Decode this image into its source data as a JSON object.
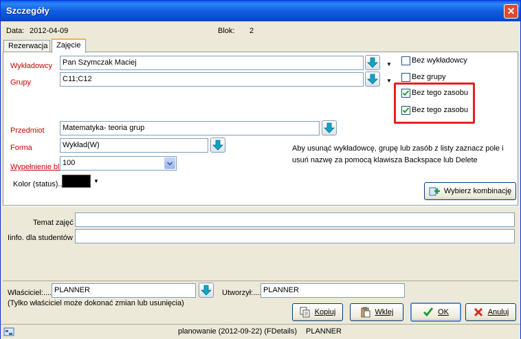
{
  "window": {
    "title": "Szczegóły"
  },
  "info": {
    "date_label": "Data:",
    "date_value": "2012-04-09",
    "block_label": "Blok:",
    "block_value": "2"
  },
  "tabs": [
    {
      "label": "Rezerwacja"
    },
    {
      "label": "Zajęcie"
    }
  ],
  "form": {
    "wykladowcy_label": "Wykładowcy",
    "wykladowcy_value": "Pan Szymczak Maciej",
    "grupy_label": "Grupy",
    "grupy_value": "C11;C12",
    "przedmiot_label": "Przedmiot",
    "przedmiot_value": "Matematyka- teoria grup",
    "forma_label": "Forma",
    "forma_value": "Wykład(W)",
    "wypelnienie_label": "Wypełnienie bl.",
    "wypelnienie_value": "100",
    "kolor_label": "Kolor (status)..",
    "kolor_value": "#000000"
  },
  "checkboxes": [
    {
      "label": "Bez wykładowcy",
      "checked": false
    },
    {
      "label": "Bez grupy",
      "checked": false
    },
    {
      "label": "Bez tego zasobu",
      "checked": true
    },
    {
      "label": "Bez tego zasobu",
      "checked": true
    }
  ],
  "help_text": {
    "line1": "Aby usunąć wykładowcę, grupę lub zasób z listy zaznacz pole i",
    "line2": "usuń nazwę za pomocą klawisza Backspace lub Delete"
  },
  "wybierz_button": "Wybierz kombinację",
  "lower": {
    "temat_label": "Temat zajęć",
    "temat_value": "",
    "info_label": "Iinfo. dla studentów",
    "info_value": ""
  },
  "owner": {
    "wlasciciel_label": "Właściciel:....",
    "wlasciciel_value": "PLANNER",
    "utworzyl_label": "Utworzył:....",
    "utworzyl_value": "PLANNER",
    "note": "(Tylko właściciel może dokonać zmian lub usunięcia)"
  },
  "buttons": {
    "kopiuj": "Kopiuj",
    "wklej": "Wklej",
    "ok": "OK",
    "anuluj": "Anuluj"
  },
  "status": {
    "app": "planowanie (2012-09-22) (FDetails)",
    "user": "PLANNER"
  },
  "colors": {
    "required_label": "#cc0000",
    "title_bar": "#0a5fe6",
    "highlight": "#e52020"
  }
}
